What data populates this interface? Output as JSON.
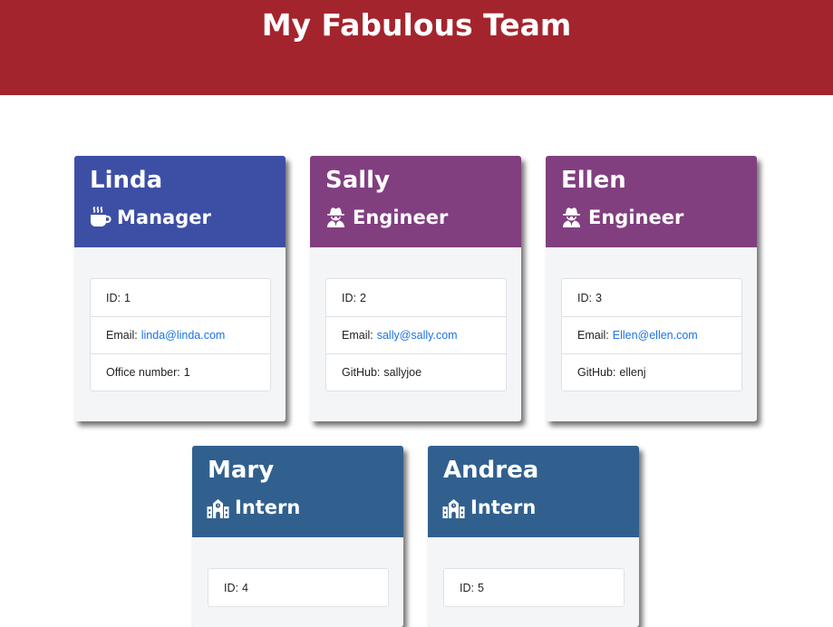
{
  "page": {
    "title": "My Fabulous Team"
  },
  "colors": {
    "header": "#a4242d",
    "manager": "#3d4fa5",
    "engineer": "#813f80",
    "intern": "#31608f",
    "link": "#1a73e8"
  },
  "cards": [
    {
      "name": "Linda",
      "role": "Manager",
      "icon": "coffee-mug-icon",
      "id_label": "ID:",
      "id": "1",
      "email_label": "Email:",
      "email": "linda@linda.com",
      "extra_label": "Office number:",
      "extra": "1"
    },
    {
      "name": "Sally",
      "role": "Engineer",
      "icon": "user-secret-icon",
      "id_label": "ID:",
      "id": "2",
      "email_label": "Email:",
      "email": "sally@sally.com",
      "extra_label": "GitHub:",
      "extra": "sallyjoe"
    },
    {
      "name": "Ellen",
      "role": "Engineer",
      "icon": "user-secret-icon",
      "id_label": "ID:",
      "id": "3",
      "email_label": "Email:",
      "email": "Ellen@ellen.com",
      "extra_label": "GitHub:",
      "extra": "ellenj"
    },
    {
      "name": "Mary",
      "role": "Intern",
      "icon": "school-icon",
      "id_label": "ID:",
      "id": "4"
    },
    {
      "name": "Andrea",
      "role": "Intern",
      "icon": "school-icon",
      "id_label": "ID:",
      "id": "5"
    }
  ]
}
